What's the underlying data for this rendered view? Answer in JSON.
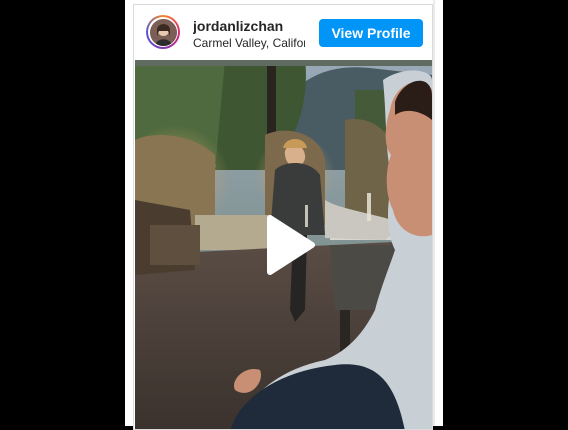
{
  "header": {
    "username": "jordanlizchan",
    "location": "Carmel Valley, California",
    "view_profile_label": "View Profile",
    "avatar_icon": "profile-photo",
    "accent_color": "#0095f6"
  },
  "media": {
    "type": "video",
    "play_icon": "play-icon"
  }
}
